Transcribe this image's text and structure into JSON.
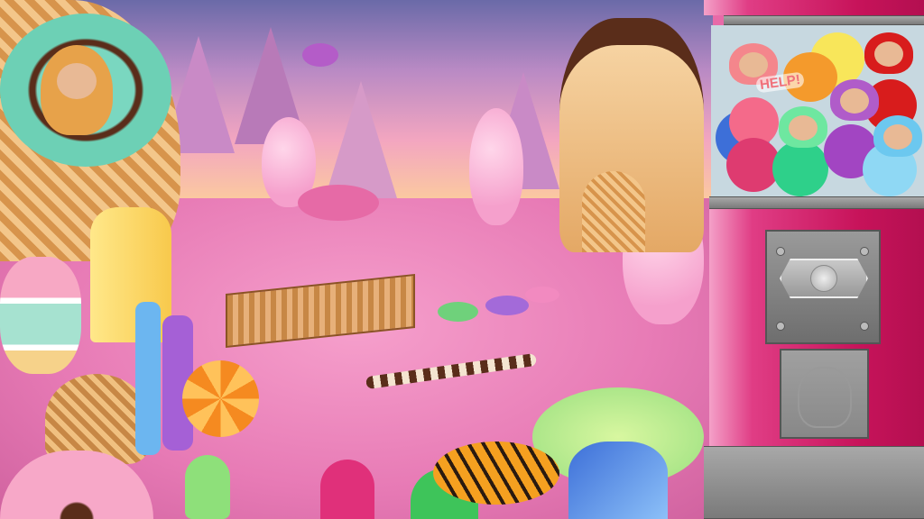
{
  "game": {
    "scene": "candy-land",
    "speech_bubble": "HELP!",
    "machine_color": "#c7135a",
    "pets": [
      {
        "color": "#f4868c",
        "state": "crying"
      },
      {
        "color": "#d81c1c",
        "state": "watching"
      },
      {
        "color": "#6ee7a0",
        "state": "sleeping"
      },
      {
        "color": "#b05cc9",
        "state": "angry"
      },
      {
        "color": "#6cc8ef",
        "state": "shocked"
      }
    ]
  }
}
